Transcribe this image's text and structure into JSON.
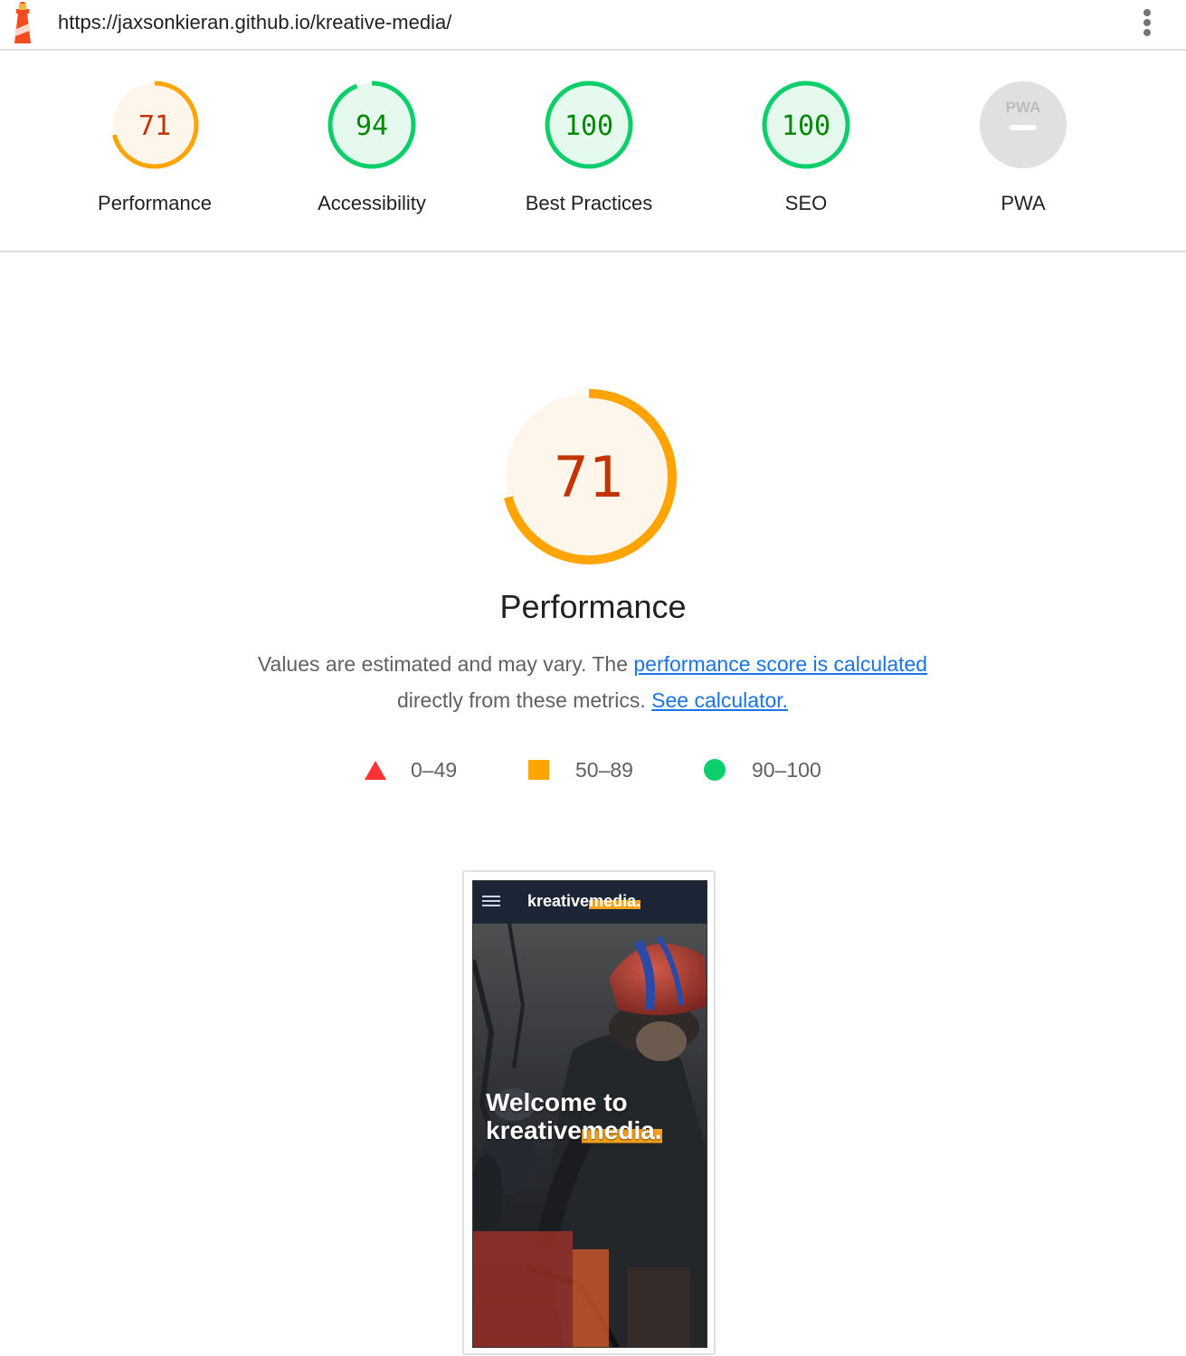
{
  "topbar": {
    "url": "https://jaxsonkieran.github.io/kreative-media/",
    "logo_icon": "lighthouse-icon",
    "menu_icon": "more-vert-icon"
  },
  "colors": {
    "average": "#ffa400",
    "average_text": "#c33300",
    "average_bg": "#fff6eb",
    "pass": "#0cce6b",
    "pass_text": "#008800",
    "pass_bg": "#e6f9ef",
    "fail": "#ff3333",
    "na": "#e0e0e0",
    "link": "#1a73e8"
  },
  "categories": [
    {
      "label": "Performance",
      "score": "71",
      "value": 0.71,
      "rating": "average"
    },
    {
      "label": "Accessibility",
      "score": "94",
      "value": 0.94,
      "rating": "pass"
    },
    {
      "label": "Best Practices",
      "score": "100",
      "value": 1.0,
      "rating": "pass"
    },
    {
      "label": "SEO",
      "score": "100",
      "value": 1.0,
      "rating": "pass"
    },
    {
      "label": "PWA",
      "score": "",
      "value": null,
      "rating": "na",
      "badge_text": "PWA",
      "badge_icon": "pwa-badge-icon"
    }
  ],
  "main": {
    "score": "71",
    "value": 0.71,
    "title": "Performance",
    "desc_prefix": "Values are estimated and may vary. The ",
    "desc_link1": "performance score is calculated",
    "desc_middle": " directly from these metrics. ",
    "desc_link2": "See calculator."
  },
  "legend": [
    {
      "range": "0–49",
      "icon": "triangle-fail-icon"
    },
    {
      "range": "50–89",
      "icon": "square-average-icon"
    },
    {
      "range": "90–100",
      "icon": "circle-pass-icon"
    }
  ],
  "screenshot": {
    "brand_a": "kreative",
    "brand_b": "media.",
    "headline_1": "Welcome to",
    "headline_2a": "kreative",
    "headline_2b": "media."
  }
}
